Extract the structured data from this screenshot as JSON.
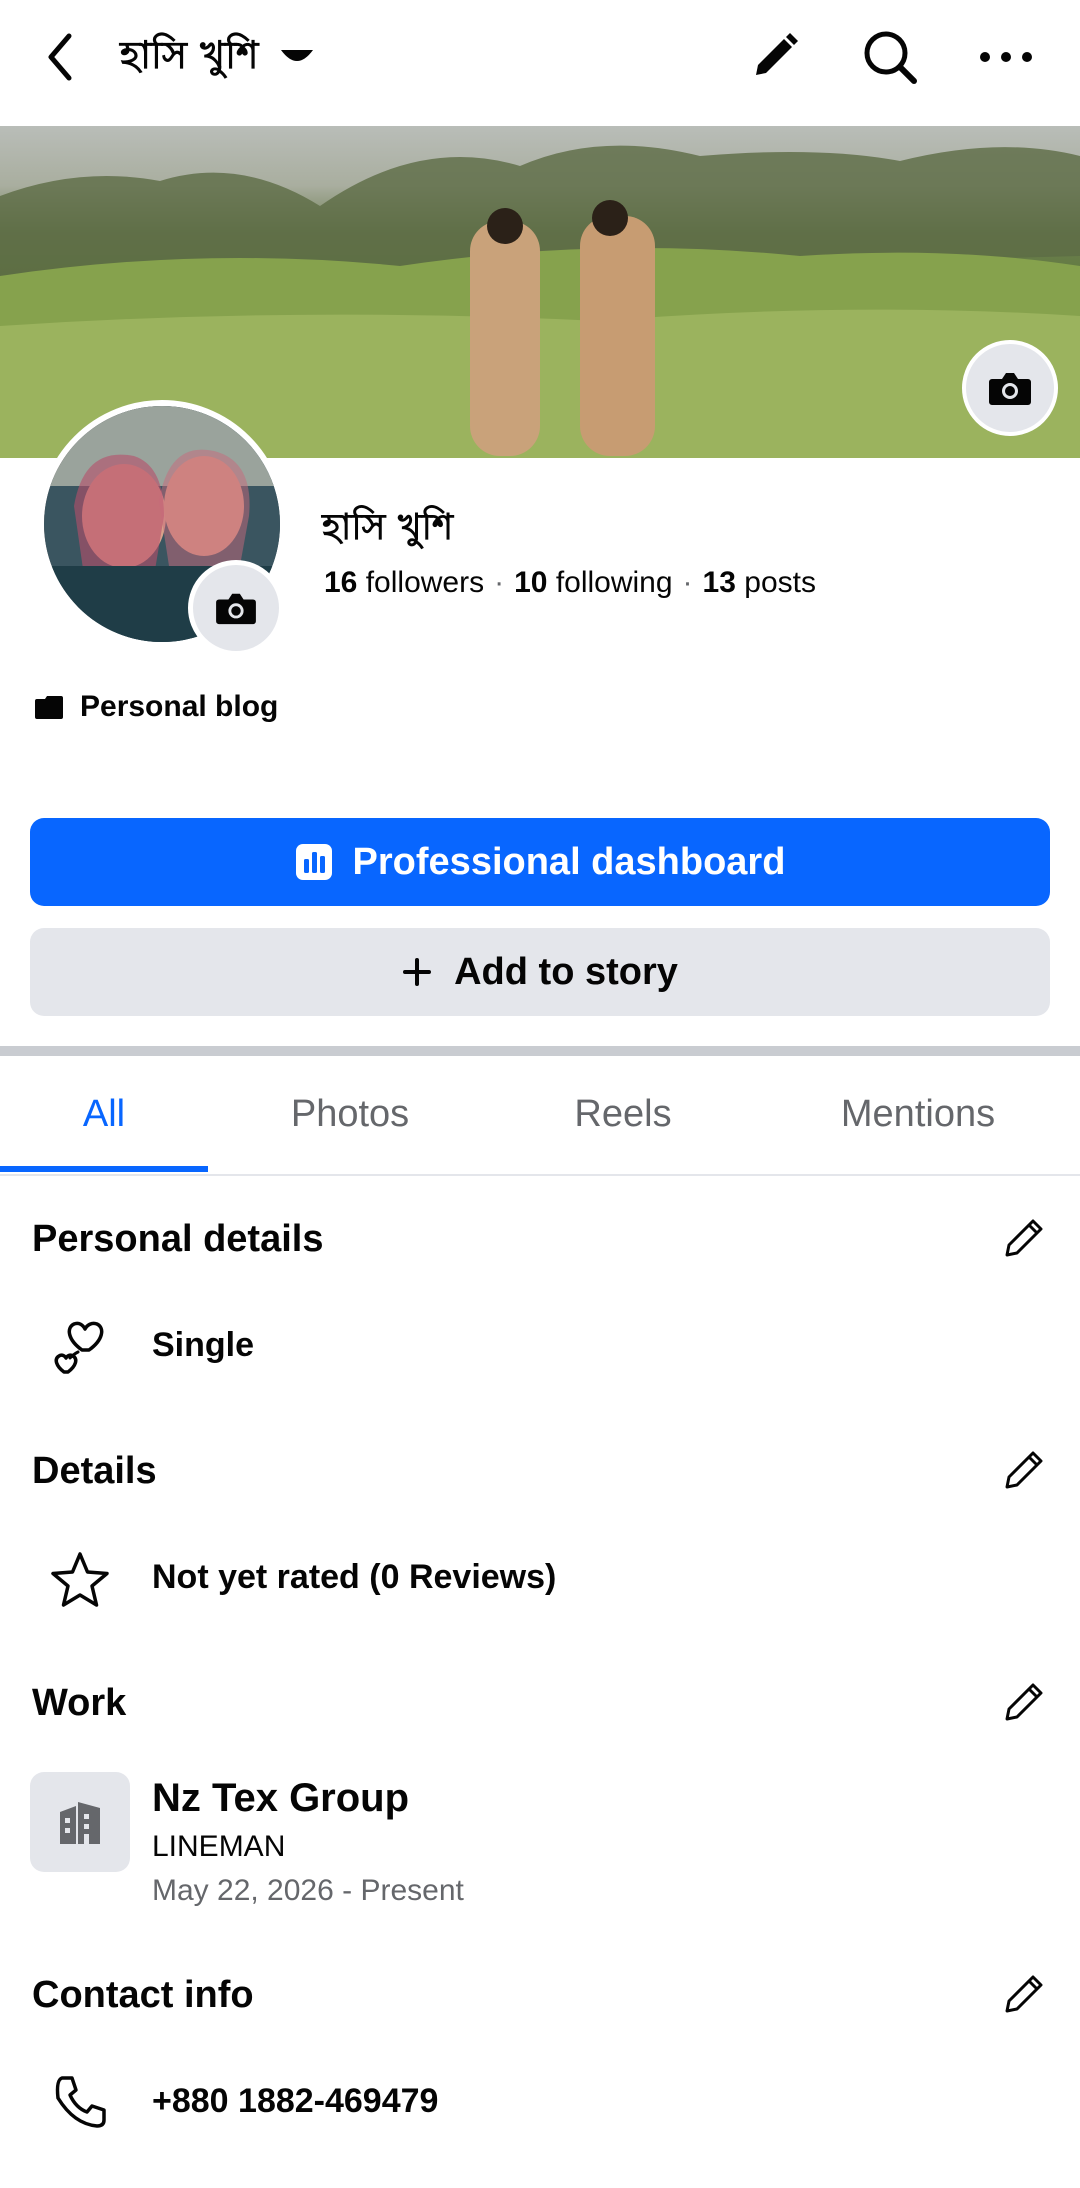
{
  "header": {
    "title": "হাসি খুশি",
    "icons": [
      "back-arrow-icon",
      "caret-down-icon",
      "pencil-icon",
      "search-icon",
      "more-icon"
    ]
  },
  "profile": {
    "name": "হাসি খুশি",
    "followers_count": "16",
    "followers_label": "followers",
    "following_count": "10",
    "following_label": "following",
    "posts_count": "13",
    "posts_label": "posts",
    "category": "Personal blog"
  },
  "buttons": {
    "professional_dashboard": "Professional dashboard",
    "add_to_story": "Add to story"
  },
  "tabs": [
    {
      "label": "All",
      "active": true
    },
    {
      "label": "Photos",
      "active": false
    },
    {
      "label": "Reels",
      "active": false
    },
    {
      "label": "Mentions",
      "active": false
    }
  ],
  "sections": {
    "personal_details": {
      "title": "Personal details",
      "relationship": "Single"
    },
    "details": {
      "title": "Details",
      "rating": "Not yet rated (0 Reviews)"
    },
    "work": {
      "title": "Work",
      "company": "Nz Tex Group",
      "role": "LINEMAN",
      "dates": "May 22, 2026 - Present"
    },
    "contact": {
      "title": "Contact info",
      "phone": "+880 1882-469479"
    }
  },
  "colors": {
    "accent": "#0866ff",
    "secondary_button": "#e4e6eb",
    "muted_text": "#65676b"
  }
}
